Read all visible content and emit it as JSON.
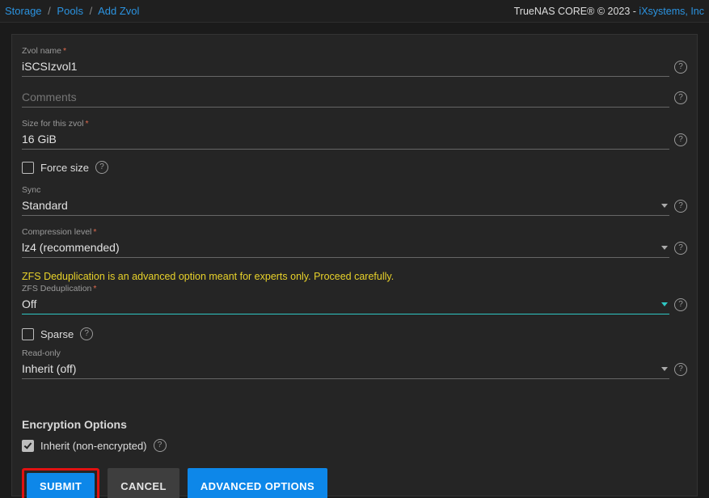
{
  "breadcrumb": {
    "storage": "Storage",
    "pools": "Pools",
    "add_zvol": "Add Zvol"
  },
  "header": {
    "product": "TrueNAS CORE® © 2023 - ",
    "vendor": "iXsystems, Inc"
  },
  "fields": {
    "zvol_name": {
      "label": "Zvol name",
      "required": "*",
      "value": "iSCSIzvol1"
    },
    "comments": {
      "label": "Comments",
      "value": ""
    },
    "size": {
      "label": "Size for this zvol",
      "required": "*",
      "value": "16 GiB"
    },
    "force_size": {
      "label": "Force size"
    },
    "sync": {
      "label": "Sync",
      "value": "Standard"
    },
    "compression": {
      "label": "Compression level",
      "required": "*",
      "value": "lz4 (recommended)"
    },
    "dedup_warning": "ZFS Deduplication is an advanced option meant for experts only. Proceed carefully.",
    "dedup": {
      "label": "ZFS Deduplication",
      "required": "*",
      "value": "Off"
    },
    "sparse": {
      "label": "Sparse"
    },
    "read_only": {
      "label": "Read-only",
      "value": "Inherit (off)"
    }
  },
  "encryption": {
    "title": "Encryption Options",
    "inherit_label": "Inherit (non-encrypted)"
  },
  "buttons": {
    "submit": "SUBMIT",
    "cancel": "CANCEL",
    "advanced": "ADVANCED OPTIONS"
  }
}
